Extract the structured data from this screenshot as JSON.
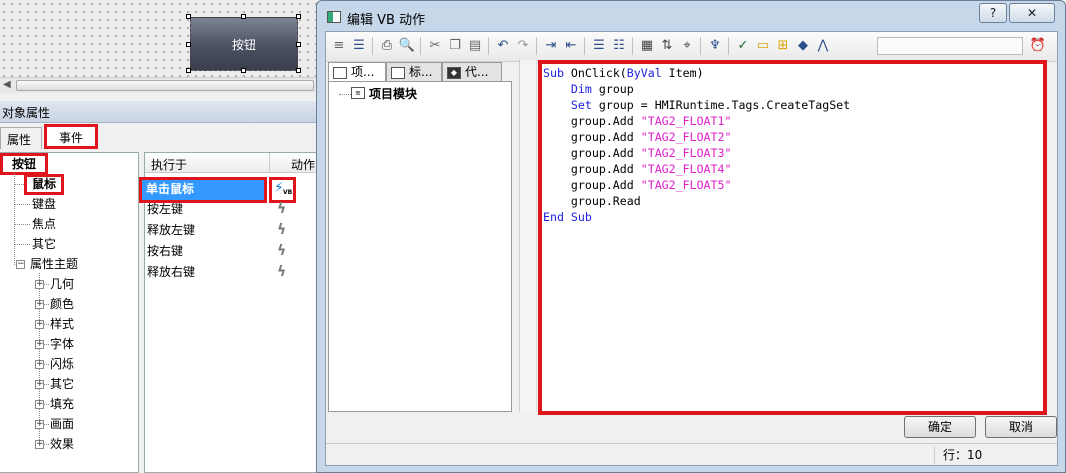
{
  "canvas": {
    "button_label": "按钮"
  },
  "properties_panel": {
    "title": "对象属性",
    "tabs": [
      "属性",
      "事件"
    ],
    "tree": {
      "root": "按钮",
      "items": [
        "鼠标",
        "键盘",
        "焦点",
        "其它"
      ],
      "group": "属性主题",
      "subitems": [
        "几何",
        "颜色",
        "样式",
        "字体",
        "闪烁",
        "其它",
        "填充",
        "画面",
        "效果"
      ]
    },
    "events": {
      "col_exec": "执行于",
      "col_action": "动作",
      "rows": [
        "单击鼠标",
        "按左键",
        "释放左键",
        "按右键",
        "释放右键"
      ],
      "vb_badge": "VB"
    }
  },
  "dialog": {
    "title": "编辑 VB 动作",
    "help": "?",
    "close": "✕",
    "left_tabs": [
      "项...",
      "标...",
      "代..."
    ],
    "tree_item": "项目模块",
    "code_lines": [
      [
        [
          "kw",
          "Sub"
        ],
        [
          "t",
          " OnClick("
        ],
        [
          "kw",
          "ByVal"
        ],
        [
          "t",
          " Item)"
        ]
      ],
      [
        [
          "t",
          "    "
        ],
        [
          "kw",
          "Dim"
        ],
        [
          "t",
          " group"
        ]
      ],
      [
        [
          "t",
          "    "
        ],
        [
          "kw",
          "Set"
        ],
        [
          "t",
          " group = HMIRuntime.Tags.CreateTagSet"
        ]
      ],
      [
        [
          "t",
          "    group.Add "
        ],
        [
          "str",
          "\"TAG2_FLOAT1\""
        ]
      ],
      [
        [
          "t",
          "    group.Add "
        ],
        [
          "str",
          "\"TAG2_FLOAT2\""
        ]
      ],
      [
        [
          "t",
          "    group.Add "
        ],
        [
          "str",
          "\"TAG2_FLOAT3\""
        ]
      ],
      [
        [
          "t",
          "    group.Add "
        ],
        [
          "str",
          "\"TAG2_FLOAT4\""
        ]
      ],
      [
        [
          "t",
          "    group.Add "
        ],
        [
          "str",
          "\"TAG2_FLOAT5\""
        ]
      ],
      [
        [
          "t",
          "    group.Read"
        ]
      ],
      [
        [
          "kw",
          "End Sub"
        ]
      ]
    ],
    "ok": "确定",
    "cancel": "取消",
    "status_label": "行：",
    "status_line": "10"
  },
  "colors": {
    "highlight": "#e0141c",
    "selection": "#3399ff",
    "keyword": "#2020e0",
    "string": "#e020c8"
  }
}
